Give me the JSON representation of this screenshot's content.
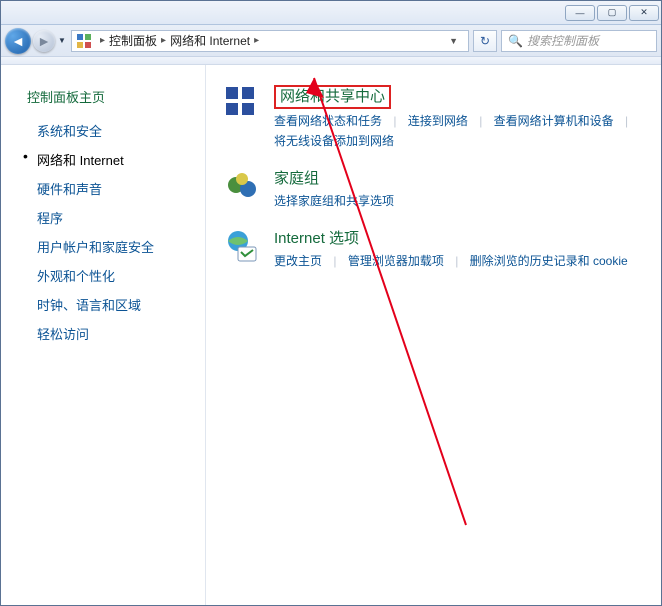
{
  "titlebar": {
    "min": "—",
    "max": "▢",
    "close": "✕"
  },
  "address": {
    "back_arrow": "◄",
    "fwd_arrow": "►",
    "drop": "▼",
    "crumb1": "控制面板",
    "crumb2": "网络和 Internet",
    "sep": "▸",
    "refresh": "↻"
  },
  "search": {
    "placeholder": "搜索控制面板",
    "icon": "🔍"
  },
  "sidebar": {
    "heading": "控制面板主页",
    "items": [
      {
        "label": "系统和安全",
        "active": false
      },
      {
        "label": "网络和 Internet",
        "active": true
      },
      {
        "label": "硬件和声音",
        "active": false
      },
      {
        "label": "程序",
        "active": false
      },
      {
        "label": "用户帐户和家庭安全",
        "active": false
      },
      {
        "label": "外观和个性化",
        "active": false
      },
      {
        "label": "时钟、语言和区域",
        "active": false
      },
      {
        "label": "轻松访问",
        "active": false
      }
    ]
  },
  "content": {
    "entries": [
      {
        "title": "网络和共享中心",
        "highlighted": true,
        "sub": [
          "查看网络状态和任务",
          "连接到网络",
          "查看网络计算机和设备",
          "将无线设备添加到网络"
        ]
      },
      {
        "title": "家庭组",
        "highlighted": false,
        "sub": [
          "选择家庭组和共享选项"
        ]
      },
      {
        "title": "Internet 选项",
        "highlighted": false,
        "sub": [
          "更改主页",
          "管理浏览器加载项",
          "删除浏览的历史记录和 cookie"
        ]
      }
    ]
  }
}
